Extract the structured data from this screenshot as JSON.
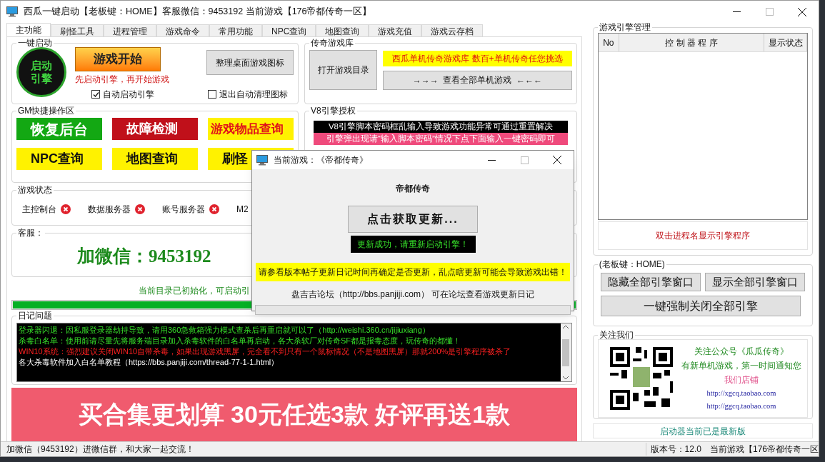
{
  "window": {
    "title": "西瓜一键启动【老板键：HOME】客服微信：9453192   当前游戏【176帝都传奇一区】"
  },
  "tabs": [
    {
      "label": "主功能",
      "selected": true
    },
    {
      "label": "刷怪工具",
      "selected": false
    },
    {
      "label": "进程管理",
      "selected": false
    },
    {
      "label": "游戏命令",
      "selected": false
    },
    {
      "label": "常用功能",
      "selected": false
    },
    {
      "label": "NPC查询",
      "selected": false
    },
    {
      "label": "地图查询",
      "selected": false
    },
    {
      "label": "游戏充值",
      "selected": false
    },
    {
      "label": "游戏云存档",
      "selected": false
    }
  ],
  "launch_group": {
    "title": "一键启动",
    "engine_button": [
      "启动",
      "引擎"
    ],
    "start_button": "游戏开始",
    "hint": "先启动引擎，再开始游戏",
    "tidy_button": "整理桌面游戏图标",
    "checkboxes": [
      {
        "label": "自动启动引擎",
        "checked": true
      },
      {
        "label": "退出自动清理图标",
        "checked": false
      }
    ]
  },
  "library_group": {
    "title": "传奇游戏库",
    "open_button": "打开游戏目录",
    "banner": "西瓜单机传奇游戏库 数百+单机传奇任您挑选",
    "view_all_button": "→→→  查看全部单机游戏  ←←←"
  },
  "gm_group": {
    "title": "GM快捷操作区",
    "buttons": [
      {
        "label": "恢复后台",
        "kind": "primary"
      },
      {
        "label": "故障检测",
        "kind": "danger"
      },
      {
        "label": "游戏物品查询",
        "kind": "featured"
      },
      {
        "label": "NPC查询",
        "kind": "plain"
      },
      {
        "label": "地图查询",
        "kind": "plain"
      },
      {
        "label": "刷怪",
        "kind": "plain"
      }
    ]
  },
  "v8_group": {
    "title": "V8引擎授权",
    "lines": [
      {
        "text": "V8引擎脚本密码框乱输入导致游戏功能异常可通过重置解决",
        "kind": "dark"
      },
      {
        "text": "引擎弹出现请“输入脚本密码”情况下点下面输入一键密码即可",
        "kind": "pink"
      }
    ]
  },
  "status_group": {
    "title": "游戏状态",
    "items": [
      {
        "label": "主控制台",
        "running": false
      },
      {
        "label": "数据服务器",
        "running": false
      },
      {
        "label": "账号服务器",
        "running": false
      },
      {
        "label": "M2"
      }
    ]
  },
  "service_group": {
    "title": "客服：",
    "text": "加微信：9453192"
  },
  "directory_status": "当前目录已初始化，可启动引",
  "progress": {
    "level": 1
  },
  "log_group": {
    "title": "日记问题",
    "lines": [
      {
        "text": "登录器闪退：因私服登录器劫持导致，请用360急救箱强力模式查杀后再重启就可以了（http://weishi.360.cn/jijiuxiang）",
        "kind": "tip"
      },
      {
        "text": "杀毒白名单：使用前请尽量先将服务端目录加入杀毒软件的白名单再启动，各大杀软厂对传奇SF都是报毒态度，玩传奇的都懂！",
        "kind": "tip"
      },
      {
        "text": "WIN10系统：强烈建议关闭WIN10自带杀毒，如果出现游戏黑屏，完全看不到只有一个鼠标情况（不是地图黑屏）那就200%是引擎程序被杀了",
        "kind": "warning"
      },
      {
        "text": "各大杀毒软件加入白名单教程（https://bbs.panjiji.com/thread-77-1-1.html）",
        "kind": "plain"
      }
    ]
  },
  "promo_banner": "买合集更划算 30元任选3款 好评再送1款",
  "status_bar": {
    "message": "加微信（9453192）进微信群，和大家一起交流！",
    "version": "版本号：12.0",
    "current_game": "当前游戏【176帝都传奇一区"
  },
  "engine_panel": {
    "title": "游戏引擎管理",
    "columns": [
      "No",
      "控 制 器 程 序",
      "显示状态"
    ],
    "hint": "双击进程名显示引擎程序"
  },
  "boss_group": {
    "title": "(老板键：HOME)",
    "buttons": [
      "隐藏全部引擎窗口",
      "显示全部引擎窗口"
    ],
    "close_all_button": "一键强制关闭全部引擎"
  },
  "follow_group": {
    "title": "关注我们",
    "account": "关注公众号《瓜瓜传奇》",
    "notice": "有新单机游戏，第一时间通知您",
    "shop": "我们店铺",
    "links": [
      "http://xgcq.taobao.com",
      "http://ggcq.taobao.com"
    ]
  },
  "update_status": "启动器当前已是最新版",
  "dialog": {
    "title": "当前游戏：《帝都传奇》",
    "game": "帝都传奇",
    "update_button": "点击获取更新...",
    "result": "更新成功，请重新启动引擎！",
    "warning": "请参看版本帖子更新日记时间再确定是否更新，乱点瞎更新可能会导致游戏出错！",
    "forum": "盘吉吉论坛（http://bbs.panjiji.com） 可在论坛查看游戏更新日记"
  }
}
